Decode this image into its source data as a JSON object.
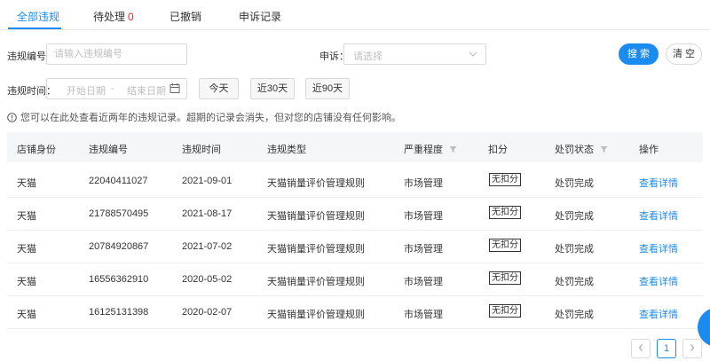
{
  "tabs": [
    {
      "label": "全部违规",
      "active": true
    },
    {
      "label": "待处理",
      "count": "0"
    },
    {
      "label": "已撤销"
    },
    {
      "label": "申诉记录"
    }
  ],
  "filters": {
    "violation_no_label": "违规编号：",
    "violation_no_placeholder": "请输入违规编号",
    "appeal_label": "申诉：",
    "appeal_placeholder": "请选择",
    "time_label": "违规时间：",
    "start_placeholder": "开始日期",
    "range_sep": "-",
    "end_placeholder": "结束日期",
    "quick": [
      "今天",
      "近30天",
      "近90天"
    ],
    "search_label": "搜 索",
    "clear_label": "清 空"
  },
  "notice": "您可以在此处查看近两年的违规记录。超期的记录会消失，但对您的店铺没有任何影响。",
  "table": {
    "headers": [
      "店铺身份",
      "违规编号",
      "违规时间",
      "违规类型",
      "严重程度",
      "扣分",
      "处罚状态",
      "操作"
    ],
    "rows": [
      [
        "天猫",
        "22040411027",
        "2021-09-01",
        "天猫销量评价管理规则",
        "市场管理",
        "无扣分",
        "处罚完成",
        "查看详情"
      ],
      [
        "天猫",
        "21788570495",
        "2021-08-17",
        "天猫销量评价管理规则",
        "市场管理",
        "无扣分",
        "处罚完成",
        "查看详情"
      ],
      [
        "天猫",
        "20784920867",
        "2021-07-02",
        "天猫销量评价管理规则",
        "市场管理",
        "无扣分",
        "处罚完成",
        "查看详情"
      ],
      [
        "天猫",
        "16556362910",
        "2020-05-02",
        "天猫销量评价管理规则",
        "市场管理",
        "无扣分",
        "处罚完成",
        "查看详情"
      ],
      [
        "天猫",
        "16125131398",
        "2020-02-07",
        "天猫销量评价管理规则",
        "市场管理",
        "无扣分",
        "处罚完成",
        "查看详情"
      ]
    ]
  },
  "pagination": {
    "current": "1",
    "prev_icon": "chevron-left-icon",
    "next_icon": "chevron-right-icon"
  },
  "colors": {
    "accent": "#1a8cf0",
    "badge": "#f5222d",
    "header_bg": "#f5f6f7"
  }
}
